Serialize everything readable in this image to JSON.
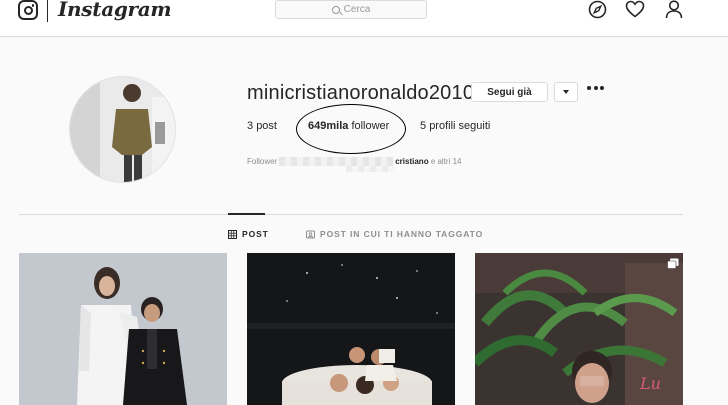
{
  "nav": {
    "brand": "Instagram",
    "search_placeholder": "Cerca",
    "icons": [
      "instagram-glyph-icon",
      "search-icon",
      "compass-icon",
      "heart-icon",
      "person-icon"
    ]
  },
  "profile": {
    "username": "minicristianoronaldo2010",
    "follow_button": "Segui già",
    "posts_count": "3",
    "posts_label": "post",
    "followers_count": "649mila",
    "followers_label": "follower",
    "following_count": "5",
    "following_label": "profili seguiti",
    "followed_by_prefix": "Follower",
    "followed_by_name": "cristiano",
    "followed_by_suffix": "e altri 14"
  },
  "tabs": [
    {
      "label": "POST",
      "active": true,
      "icon": "grid-icon"
    },
    {
      "label": "POST IN CUI TI HANNO TAGGATO",
      "active": false,
      "icon": "tag-icon"
    }
  ],
  "colors": {
    "text": "#262626",
    "muted": "#8e8e8e",
    "border": "#dbdbdb",
    "background": "#fafafa"
  }
}
